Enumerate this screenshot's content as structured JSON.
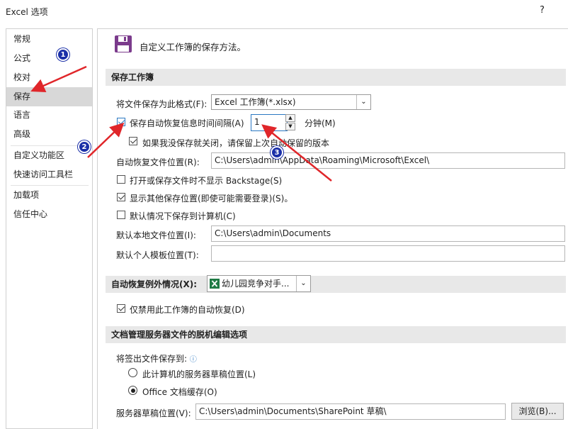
{
  "window": {
    "title": "Excel 选项",
    "help": "?"
  },
  "sidebar": {
    "items": [
      {
        "label": "常规"
      },
      {
        "label": "公式"
      },
      {
        "label": "校对"
      },
      {
        "label": "保存"
      },
      {
        "label": "语言"
      },
      {
        "label": "高级"
      },
      {
        "label": "自定义功能区"
      },
      {
        "label": "快速访问工具栏"
      },
      {
        "label": "加载项"
      },
      {
        "label": "信任中心"
      }
    ],
    "selected": "保存"
  },
  "header": {
    "text": "自定义工作簿的保存方法。",
    "icon": "floppy-disk-icon"
  },
  "save_section": {
    "title": "保存工作簿",
    "format_label": "将文件保存为此格式(F):",
    "format_value": "Excel 工作簿(*.xlsx)",
    "autorecover_label": "保存自动恢复信息时间间隔(A)",
    "autorecover_checked": true,
    "autorecover_minutes": "1",
    "minutes_unit": "分钟(M)",
    "keep_last_label": "如果我没保存就关闭，请保留上次自动保留的版本",
    "keep_last_checked": true,
    "autorecover_location_label": "自动恢复文件位置(R):",
    "autorecover_location_value": "C:\\Users\\admin\\AppData\\Roaming\\Microsoft\\Excel\\",
    "no_backstage_label": "打开或保存文件时不显示 Backstage(S)",
    "no_backstage_checked": false,
    "show_more_label": "显示其他保存位置(即使可能需要登录)(S)。",
    "show_more_checked": true,
    "default_computer_label": "默认情况下保存到计算机(C)",
    "default_computer_checked": false,
    "local_location_label": "默认本地文件位置(I):",
    "local_location_value": "C:\\Users\\admin\\Documents",
    "template_location_label": "默认个人模板位置(T):",
    "template_location_value": ""
  },
  "exceptions": {
    "label": "自动恢复例外情况(X):",
    "workbook": "幼儿园竞争对手...",
    "disable_label": "仅禁用此工作簿的自动恢复(D)",
    "disable_checked": true
  },
  "offline": {
    "title": "文档管理服务器文件的脱机编辑选项",
    "save_to_label": "将签出文件保存到:",
    "option_server": "此计算机的服务器草稿位置(L)",
    "option_office": "Office 文档缓存(O)",
    "selected": "Office 文档缓存(O)",
    "drafts_label": "服务器草稿位置(V):",
    "drafts_value": "C:\\Users\\admin\\Documents\\SharePoint 草稿\\",
    "browse_label": "浏览(B)..."
  },
  "annotations": {
    "badge1": "1",
    "badge2": "2",
    "badge3": "3",
    "arrow_color": "#e0262a"
  },
  "colors": {
    "accent": "#2b78c2",
    "section_bg": "#e8e8e8",
    "selected_nav": "#d8d8d8",
    "disk_icon": "#7b3b8c"
  }
}
